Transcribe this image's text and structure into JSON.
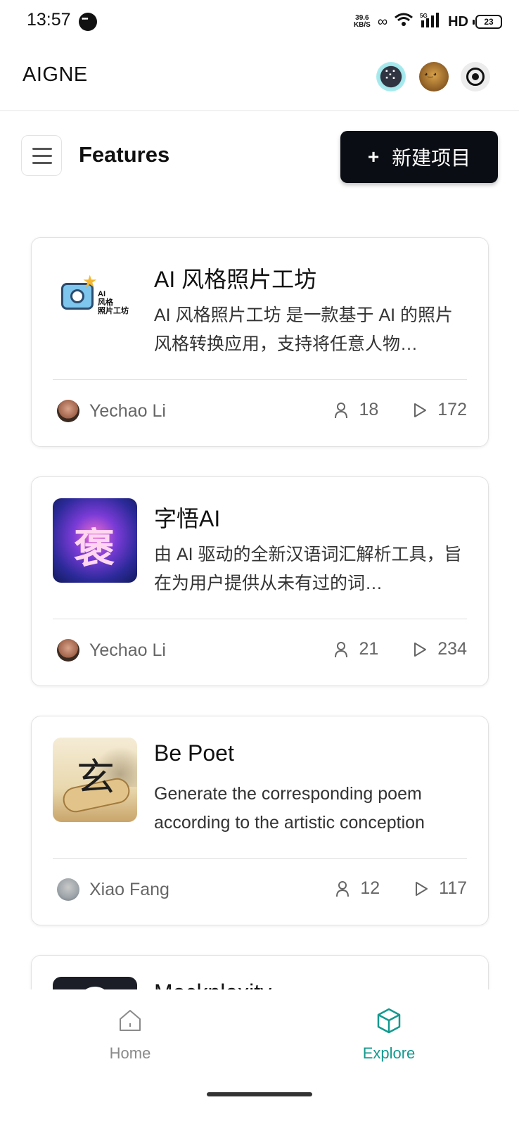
{
  "status_bar": {
    "time": "13:57",
    "net_speed_value": "39.6",
    "net_speed_unit": "KB/S",
    "network_label": "5G",
    "hd_label": "HD",
    "battery": "23"
  },
  "app_bar": {
    "title": "AIGNE"
  },
  "header": {
    "title": "Features",
    "new_button_label": "新建项目",
    "new_button_plus": "+"
  },
  "cards": [
    {
      "title": "AI 风格照片工坊",
      "description": "AI 风格照片工坊 是一款基于 AI 的照片风格转换应用，支持将任意人物…",
      "thumb_label": "AI\n风格\n照片工坊",
      "author": "Yechao Li",
      "users": "18",
      "runs": "172"
    },
    {
      "title": "字悟AI",
      "description": "由 AI 驱动的全新汉语词汇解析工具，旨在为用户提供从未有过的词…",
      "thumb_glyph": "褒",
      "author": "Yechao Li",
      "users": "21",
      "runs": "234"
    },
    {
      "title": "Be Poet",
      "description": "Generate the corresponding poem according to the artistic conception",
      "thumb_glyph": "玄",
      "author": "Xiao Fang",
      "users": "12",
      "runs": "117"
    },
    {
      "title": "Mockplexity"
    }
  ],
  "bottom_nav": {
    "home_label": "Home",
    "explore_label": "Explore"
  },
  "colors": {
    "accent": "#14998f",
    "primary_button": "#0b0d14"
  }
}
